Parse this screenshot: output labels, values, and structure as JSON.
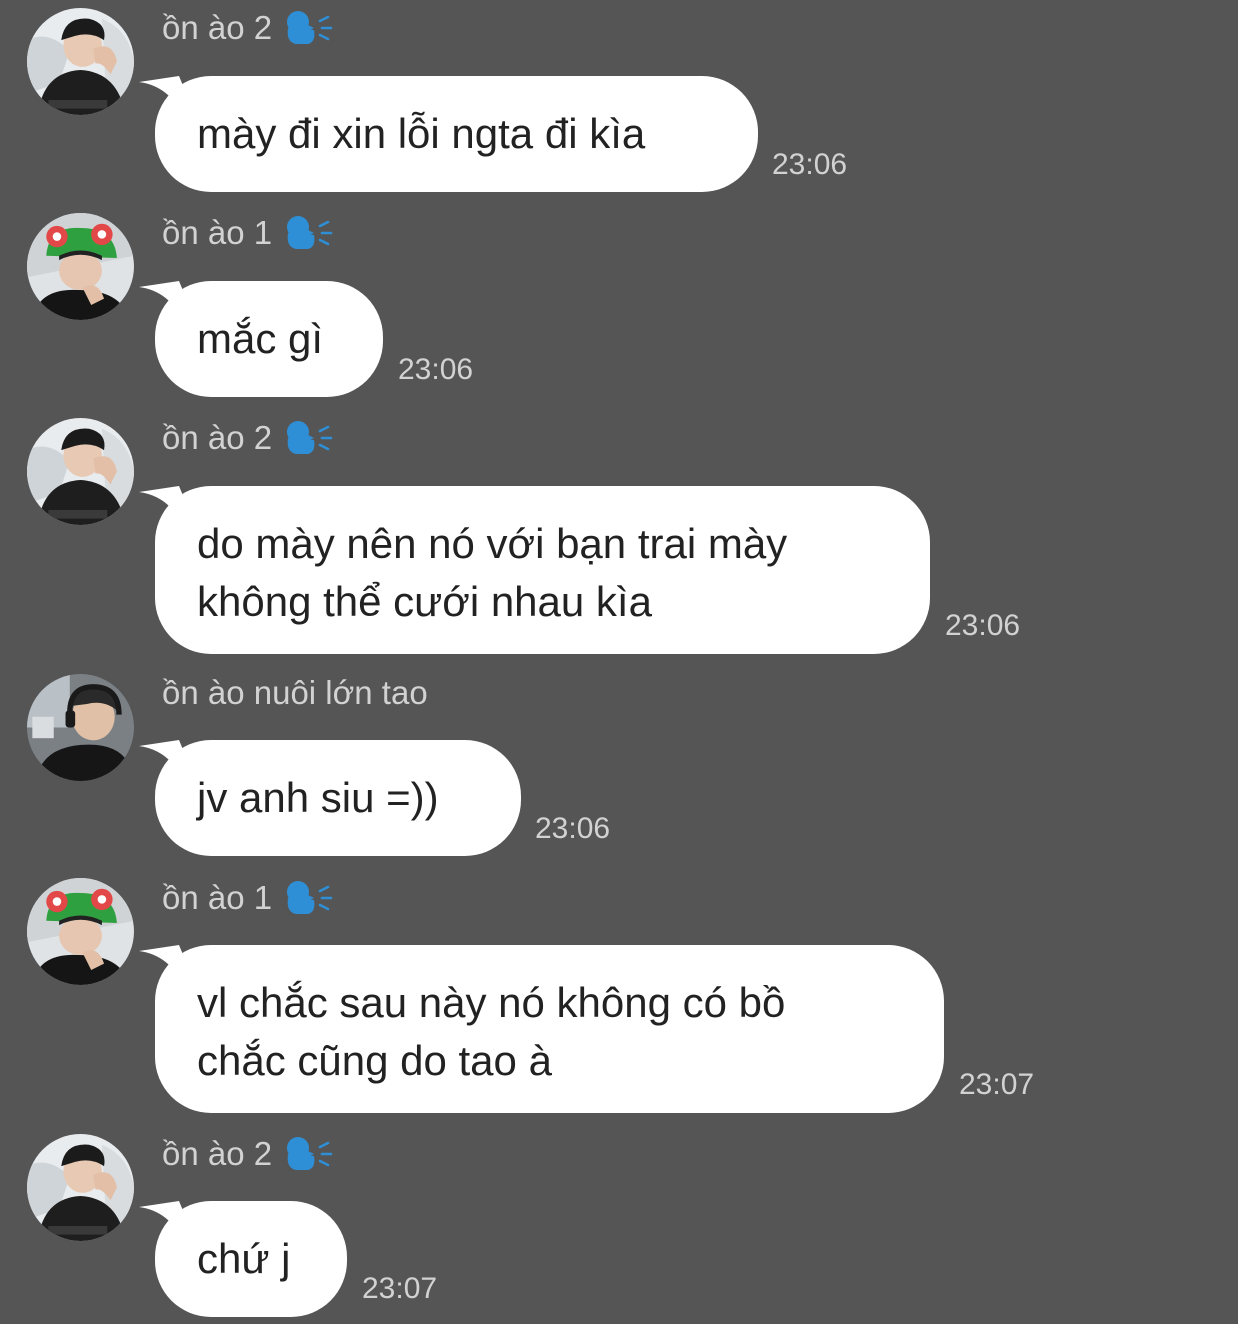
{
  "messages": [
    {
      "sender": "ồn ào 2",
      "avatar": "person-black-hoodie",
      "speaker_icon": true,
      "lines": [
        "mày đi xin lỗi ngta đi kìa"
      ],
      "time": "23:06"
    },
    {
      "sender": "ồn ào 1",
      "avatar": "person-green-frog-hat",
      "speaker_icon": true,
      "lines": [
        "mắc gì"
      ],
      "time": "23:06"
    },
    {
      "sender": "ồn ào 2",
      "avatar": "person-black-hoodie",
      "speaker_icon": true,
      "lines": [
        "do mày nên nó với bạn trai mày",
        "không thể cưới nhau kìa"
      ],
      "time": "23:06"
    },
    {
      "sender": "ồn ào nuôi lớn tao",
      "avatar": "person-headset-smiling",
      "speaker_icon": false,
      "lines": [
        "jv anh siu =))"
      ],
      "time": "23:06"
    },
    {
      "sender": "ồn ào 1",
      "avatar": "person-green-frog-hat",
      "speaker_icon": true,
      "lines": [
        "vl chắc sau này nó không có bồ",
        "chắc cũng do tao à"
      ],
      "time": "23:07"
    },
    {
      "sender": "ồn ào 2",
      "avatar": "person-black-hoodie",
      "speaker_icon": true,
      "lines": [
        "chứ j"
      ],
      "time": "23:07"
    }
  ],
  "colors": {
    "background": "#555555",
    "bubble": "#ffffff",
    "meta_text": "#d2d2d2",
    "speaker_icon": "#2f8fd6"
  }
}
